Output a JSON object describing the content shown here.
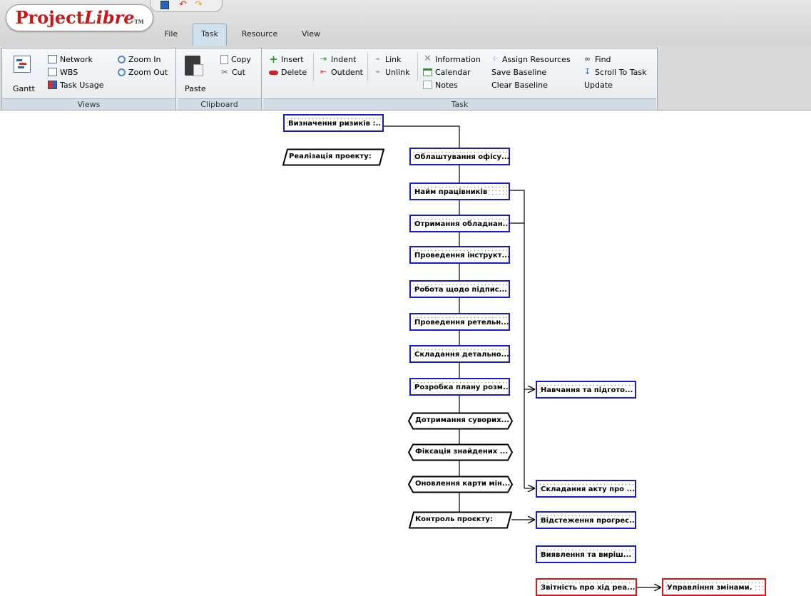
{
  "app": {
    "logo": {
      "main": "Project",
      "italic": "Libre",
      "tm": "TM"
    }
  },
  "tabs": [
    {
      "label": "File"
    },
    {
      "label": "Task"
    },
    {
      "label": "Resource"
    },
    {
      "label": "View"
    }
  ],
  "ribbon": {
    "views": {
      "label": "Views",
      "gantt": "Gantt",
      "network": "Network",
      "wbs": "WBS",
      "task_usage": "Task Usage",
      "zoom_in": "Zoom In",
      "zoom_out": "Zoom Out"
    },
    "clipboard": {
      "label": "Clipboard",
      "paste": "Paste",
      "copy": "Copy",
      "cut": "Cut"
    },
    "task": {
      "label": "Task",
      "insert": "Insert",
      "delete": "Delete",
      "indent": "Indent",
      "outdent": "Outdent",
      "link": "Link",
      "unlink": "Unlink",
      "information": "Information",
      "calendar": "Calendar",
      "notes": "Notes",
      "assign_resources": "Assign Resources",
      "save_baseline": "Save Baseline",
      "clear_baseline": "Clear Baseline",
      "find": "Find",
      "scroll_to_task": "Scroll To Task",
      "update": "Update"
    }
  },
  "colors": {
    "node_blue": "#1a1ad6",
    "node_red": "#e01616",
    "tab_active": "#cfe1ef"
  },
  "diagram": {
    "nodes": [
      {
        "text": "Визначення ризиків :..",
        "shape": "blue"
      },
      {
        "text": "Реалізація проекту:",
        "shape": "parallelogram"
      },
      {
        "text": "Облаштування офісу...",
        "shape": "blue"
      },
      {
        "text": "Найм працівників",
        "shape": "blue"
      },
      {
        "text": "Отримання обладнан...",
        "shape": "blue"
      },
      {
        "text": "Проведення інструкт...",
        "shape": "blue"
      },
      {
        "text": "Робота щодо підпис...",
        "shape": "blue"
      },
      {
        "text": "Проведення ретельн...",
        "shape": "blue"
      },
      {
        "text": "Складання детально...",
        "shape": "blue"
      },
      {
        "text": "Розробка плану розм...",
        "shape": "blue"
      },
      {
        "text": "Дотримання суворих...",
        "shape": "hexagon"
      },
      {
        "text": "Фіксація знайдених ...",
        "shape": "hexagon"
      },
      {
        "text": "Оновлення карти мін...",
        "shape": "hexagon"
      },
      {
        "text": "Контроль проєкту:",
        "shape": "parallelogram"
      },
      {
        "text": "Навчання та підгото...",
        "shape": "blue"
      },
      {
        "text": "Складання акту про ...",
        "shape": "blue"
      },
      {
        "text": "Відстеження прогрес...",
        "shape": "blue"
      },
      {
        "text": "Виявлення та виріш...",
        "shape": "blue"
      },
      {
        "text": "Звітність про хід реа...",
        "shape": "red"
      },
      {
        "text": "Управління змінами.",
        "shape": "red"
      }
    ]
  }
}
